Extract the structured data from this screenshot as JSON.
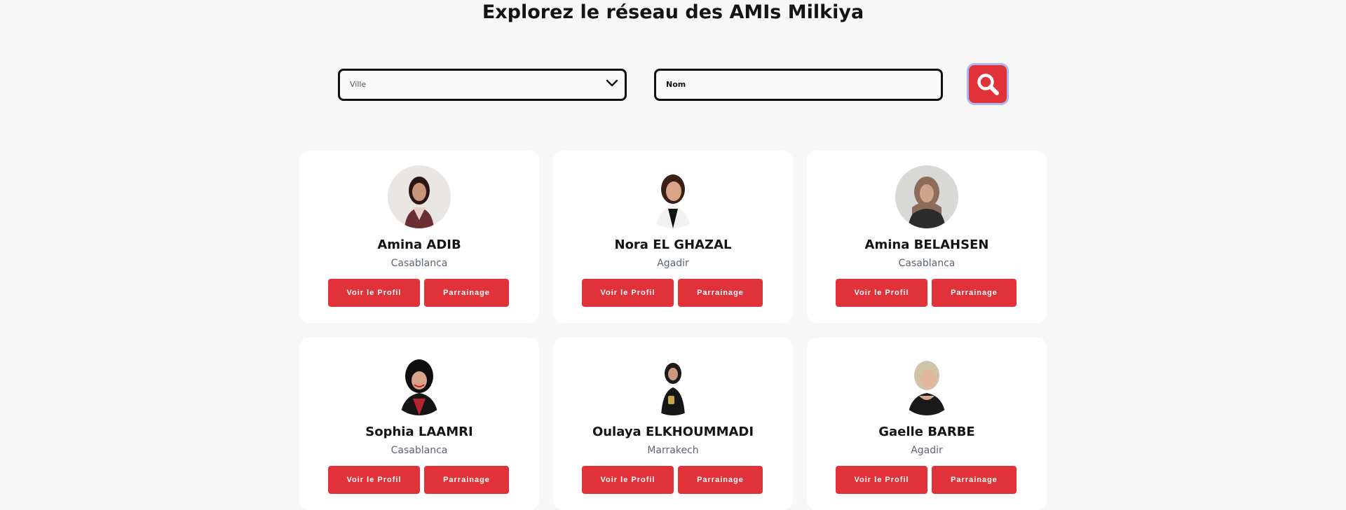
{
  "page": {
    "title": "Explorez le réseau des AMIs Milkiya"
  },
  "filters": {
    "city_select": {
      "value": "Ville"
    },
    "name_input": {
      "value": "Nom"
    },
    "search_button_icon": "search-icon"
  },
  "colors": {
    "accent": "#e1323a",
    "background": "#f6f7f6",
    "card": "#ffffff"
  },
  "members": [
    {
      "name": "Amina ADIB",
      "city": "Casablanca",
      "profile_label": "Voir le Profil",
      "referral_label": "Parrainage"
    },
    {
      "name": "Nora EL GHAZAL",
      "city": "Agadir",
      "profile_label": "Voir le Profil",
      "referral_label": "Parrainage"
    },
    {
      "name": "Amina BELAHSEN",
      "city": "Casablanca",
      "profile_label": "Voir le Profil",
      "referral_label": "Parrainage"
    },
    {
      "name": "Sophia LAAMRI",
      "city": "Casablanca",
      "profile_label": "Voir le Profil",
      "referral_label": "Parrainage"
    },
    {
      "name": "Oulaya ELKHOUMMADI",
      "city": "Marrakech",
      "profile_label": "Voir le Profil",
      "referral_label": "Parrainage"
    },
    {
      "name": "Gaelle BARBE",
      "city": "Agadir",
      "profile_label": "Voir le Profil",
      "referral_label": "Parrainage"
    }
  ]
}
